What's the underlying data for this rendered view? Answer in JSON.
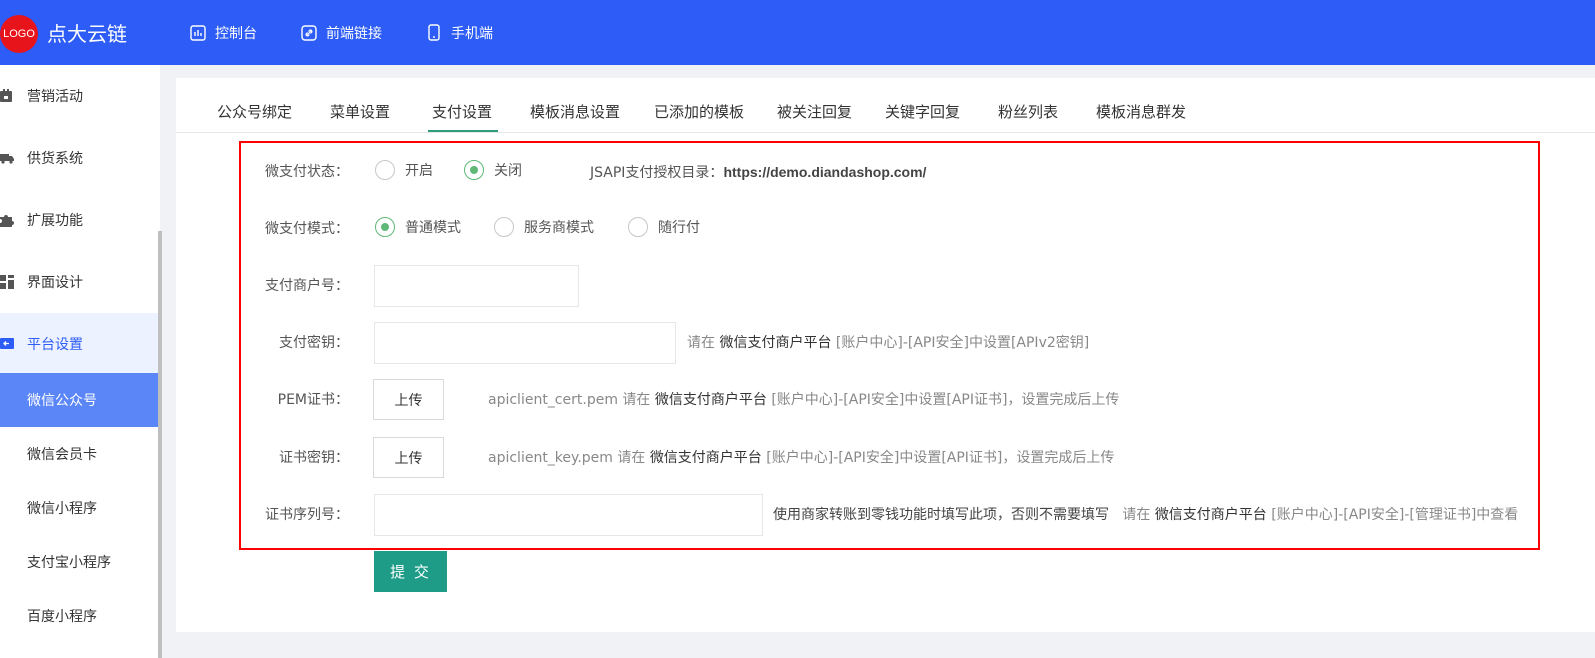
{
  "brand": {
    "logo_text": "LOGO",
    "name": "点大云链"
  },
  "topnav": [
    {
      "label": "控制台",
      "icon": "dashboard-icon"
    },
    {
      "label": "前端链接",
      "icon": "link-icon"
    },
    {
      "label": "手机端",
      "icon": "mobile-icon"
    }
  ],
  "sidebar": {
    "items": [
      {
        "label": "营销活动",
        "icon": "calendar-icon"
      },
      {
        "label": "供货系统",
        "icon": "truck-icon"
      },
      {
        "label": "扩展功能",
        "icon": "puzzle-icon"
      },
      {
        "label": "界面设计",
        "icon": "layout-icon"
      },
      {
        "label": "平台设置",
        "icon": "settings-icon"
      }
    ],
    "sub_items": [
      "微信公众号",
      "微信会员卡",
      "微信小程序",
      "支付宝小程序",
      "百度小程序"
    ],
    "active_sub": "微信公众号"
  },
  "tabs": [
    "公众号绑定",
    "菜单设置",
    "支付设置",
    "模板消息设置",
    "已添加的模板",
    "被关注回复",
    "关键字回复",
    "粉丝列表",
    "模板消息群发"
  ],
  "active_tab": "支付设置",
  "form": {
    "status": {
      "label": "微支付状态：",
      "options": [
        "开启",
        "关闭"
      ],
      "selected": "关闭",
      "jsapi_label": "JSAPI支付授权目录：",
      "jsapi_url": "https://demo.diandashop.com/"
    },
    "mode": {
      "label": "微支付模式：",
      "options": [
        "普通模式",
        "服务商模式",
        "随行付"
      ],
      "selected": "普通模式"
    },
    "merchant_id": {
      "label": "支付商户号：",
      "value": ""
    },
    "pay_key": {
      "label": "支付密钥：",
      "value": "",
      "hint_pre": "请在",
      "hint_platform": "微信支付商户平台",
      "hint_post": "[账户中心]-[API安全]中设置[APIv2密钥]"
    },
    "pem_cert": {
      "label": "PEM证书：",
      "button": "上传",
      "hint_pre": "apiclient_cert.pem 请在",
      "hint_platform": "微信支付商户平台",
      "hint_post": "[账户中心]-[API安全]中设置[API证书]，设置完成后上传"
    },
    "cert_key": {
      "label": "证书密钥：",
      "button": "上传",
      "hint_pre": "apiclient_key.pem 请在",
      "hint_platform": "微信支付商户平台",
      "hint_post": "[账户中心]-[API安全]中设置[API证书]，设置完成后上传"
    },
    "cert_serial": {
      "label": "证书序列号：",
      "value": "",
      "hint_note": "使用商家转账到零钱功能时填写此项，否则不需要填写",
      "hint_pre": "请在",
      "hint_platform": "微信支付商户平台",
      "hint_post": "[账户中心]-[API安全]-[管理证书]中查看"
    },
    "submit": "提 交"
  },
  "colors": {
    "topbar": "#2d5cf6",
    "accent_green": "#1e9c88",
    "radio_on": "#5fb878",
    "highlight_box": "#ff0000"
  }
}
